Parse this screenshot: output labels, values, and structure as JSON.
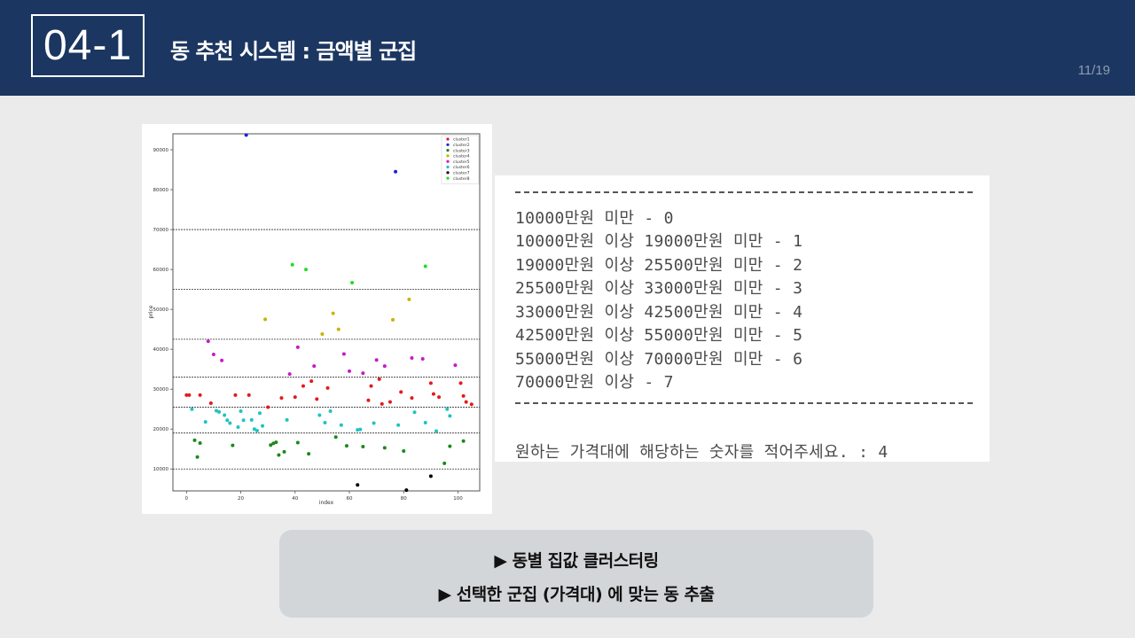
{
  "header": {
    "section": "04-1",
    "title": "동 추천 시스템 : 금액별 군집",
    "page": "11/19"
  },
  "console": {
    "separator": "------------------------------------------------",
    "lines": [
      "10000만원 미만 - 0",
      "10000만원 이상 19000만원 미만 - 1",
      "19000만원 이상 25500만원 미만 - 2",
      "25500만원 이상 33000만원 미만 - 3",
      "33000만원 이상 42500만원 미만 - 4",
      "42500만원 이상 55000만원 미만 - 5",
      "55000먼원 이상 70000만원 미만 - 6",
      "70000만원 이상 - 7"
    ],
    "prompt": "원하는 가격대에 해당하는 숫자를 적어주세요. : 4"
  },
  "note": {
    "line1": "▶  동별 집값 클러스터링",
    "line2": "▶ 선택한 군집 (가격대) 에 맞는 동 추출"
  },
  "chart_data": {
    "type": "scatter",
    "xlabel": "index",
    "ylabel": "price",
    "xlim": [
      -5,
      108
    ],
    "ylim": [
      4500,
      94000
    ],
    "xticks": [
      "0",
      "20",
      "40",
      "60",
      "80",
      "100"
    ],
    "xtick_values": [
      0,
      20,
      40,
      60,
      80,
      100
    ],
    "yticks": [
      "10000",
      "20000",
      "30000",
      "40000",
      "50000",
      "60000",
      "70000",
      "80000",
      "90000"
    ],
    "ytick_values": [
      10000,
      20000,
      30000,
      40000,
      50000,
      60000,
      70000,
      80000,
      90000
    ],
    "hlines": [
      10000,
      19000,
      25500,
      33000,
      42500,
      55000,
      70000
    ],
    "legend_position": "top-right",
    "series": [
      {
        "name": "cluster1",
        "color": "#e31a1c",
        "points": [
          [
            0,
            28500
          ],
          [
            1,
            28500
          ],
          [
            5,
            28500
          ],
          [
            9,
            26500
          ],
          [
            18,
            28500
          ],
          [
            23,
            28500
          ],
          [
            30,
            25500
          ],
          [
            35,
            27800
          ],
          [
            40,
            28000
          ],
          [
            43,
            30800
          ],
          [
            46,
            32000
          ],
          [
            48,
            27500
          ],
          [
            52,
            30300
          ],
          [
            67,
            27200
          ],
          [
            68,
            30800
          ],
          [
            71,
            32500
          ],
          [
            72,
            26300
          ],
          [
            75,
            26800
          ],
          [
            79,
            29300
          ],
          [
            83,
            27800
          ],
          [
            90,
            31500
          ],
          [
            91,
            28800
          ],
          [
            93,
            28000
          ],
          [
            101,
            31500
          ],
          [
            102,
            28300
          ],
          [
            103,
            26800
          ],
          [
            105,
            26200
          ]
        ]
      },
      {
        "name": "cluster2",
        "color": "#1f1fd6",
        "points": [
          [
            22,
            93700
          ],
          [
            77,
            84500
          ]
        ]
      },
      {
        "name": "cluster3",
        "color": "#1a8a1a",
        "points": [
          [
            3,
            17200
          ],
          [
            4,
            13000
          ],
          [
            5,
            16500
          ],
          [
            17,
            15900
          ],
          [
            31,
            16000
          ],
          [
            32,
            16400
          ],
          [
            33,
            16700
          ],
          [
            34,
            13500
          ],
          [
            36,
            14300
          ],
          [
            41,
            16600
          ],
          [
            45,
            13800
          ],
          [
            55,
            18000
          ],
          [
            59,
            15800
          ],
          [
            65,
            15600
          ],
          [
            73,
            15300
          ],
          [
            80,
            14500
          ],
          [
            95,
            11400
          ],
          [
            97,
            15700
          ],
          [
            102,
            17000
          ]
        ]
      },
      {
        "name": "cluster4",
        "color": "#c8b400",
        "points": [
          [
            29,
            47500
          ],
          [
            50,
            43800
          ],
          [
            54,
            49000
          ],
          [
            56,
            45000
          ],
          [
            76,
            47400
          ],
          [
            82,
            52500
          ]
        ]
      },
      {
        "name": "cluster5",
        "color": "#c71ac7",
        "points": [
          [
            8,
            42000
          ],
          [
            10,
            38700
          ],
          [
            13,
            37200
          ],
          [
            38,
            33800
          ],
          [
            41,
            40500
          ],
          [
            47,
            35800
          ],
          [
            58,
            38800
          ],
          [
            60,
            34500
          ],
          [
            65,
            34000
          ],
          [
            70,
            37300
          ],
          [
            73,
            35800
          ],
          [
            83,
            37800
          ],
          [
            87,
            37600
          ],
          [
            99,
            36000
          ]
        ]
      },
      {
        "name": "cluster6",
        "color": "#1ec3c3",
        "points": [
          [
            2,
            25000
          ],
          [
            7,
            21800
          ],
          [
            11,
            24600
          ],
          [
            12,
            24300
          ],
          [
            14,
            23500
          ],
          [
            15,
            22200
          ],
          [
            16,
            21500
          ],
          [
            19,
            20500
          ],
          [
            20,
            24500
          ],
          [
            21,
            22200
          ],
          [
            24,
            22300
          ],
          [
            25,
            20000
          ],
          [
            26,
            19600
          ],
          [
            27,
            24000
          ],
          [
            28,
            20800
          ],
          [
            37,
            22300
          ],
          [
            49,
            23500
          ],
          [
            51,
            21600
          ],
          [
            53,
            24500
          ],
          [
            57,
            21000
          ],
          [
            63,
            19800
          ],
          [
            64,
            19900
          ],
          [
            69,
            21500
          ],
          [
            78,
            21000
          ],
          [
            84,
            24200
          ],
          [
            88,
            21600
          ],
          [
            92,
            19500
          ],
          [
            96,
            25000
          ],
          [
            97,
            23300
          ]
        ]
      },
      {
        "name": "cluster7",
        "color": "#000000",
        "points": [
          [
            63,
            6000
          ],
          [
            81,
            4700
          ],
          [
            90,
            8200
          ]
        ]
      },
      {
        "name": "cluster8",
        "color": "#22dd22",
        "points": [
          [
            39,
            61200
          ],
          [
            44,
            60000
          ],
          [
            61,
            56700
          ],
          [
            88,
            60800
          ]
        ]
      }
    ]
  }
}
